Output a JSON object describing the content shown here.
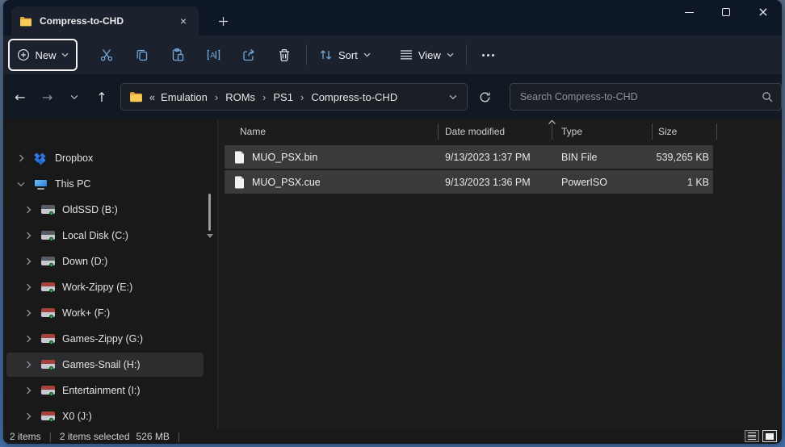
{
  "colors": {
    "accent_icon_blue": "#70a9dc",
    "folder_yellow": "#f8c955",
    "selection_gray": "#3a3a3c",
    "dropbox_blue": "#2f7cf0",
    "drive_led_green": "#2fae4e",
    "drive_stripe_red": "#a8423c",
    "titlebar_navy": "#0d1726"
  },
  "titlebar": {
    "tab_title": "Compress-to-CHD",
    "close_tab_glyph": "×",
    "close_window_glyph": "×"
  },
  "toolbar": {
    "new_label": "New",
    "sort_label": "Sort",
    "view_label": "View"
  },
  "addressbar": {
    "overflow_indicator": "«",
    "separator": "›",
    "crumbs": [
      "Emulation",
      "ROMs",
      "PS1",
      "Compress-to-CHD"
    ]
  },
  "search": {
    "placeholder": "Search Compress-to-CHD"
  },
  "sidebar": {
    "items": [
      {
        "label": "Dropbox",
        "icon": "dropbox-icon",
        "level": 0,
        "expanded": false,
        "highlighted": false
      },
      {
        "label": "This PC",
        "icon": "computer-icon",
        "level": 0,
        "expanded": true,
        "highlighted": false
      },
      {
        "label": "OldSSD (B:)",
        "icon": "drive-icon",
        "level": 1,
        "expanded": false,
        "highlighted": false
      },
      {
        "label": "Local Disk (C:)",
        "icon": "drive-icon",
        "level": 1,
        "expanded": false,
        "highlighted": false
      },
      {
        "label": "Down (D:)",
        "icon": "drive-icon",
        "level": 1,
        "expanded": false,
        "highlighted": false
      },
      {
        "label": "Work-Zippy (E:)",
        "icon": "drive-red-icon",
        "level": 1,
        "expanded": false,
        "highlighted": false
      },
      {
        "label": "Work+ (F:)",
        "icon": "drive-red-icon",
        "level": 1,
        "expanded": false,
        "highlighted": false
      },
      {
        "label": "Games-Zippy (G:)",
        "icon": "drive-red-icon",
        "level": 1,
        "expanded": false,
        "highlighted": false
      },
      {
        "label": "Games-Snail (H:)",
        "icon": "drive-red-icon",
        "level": 1,
        "expanded": false,
        "highlighted": true
      },
      {
        "label": "Entertainment (I:)",
        "icon": "drive-red-icon",
        "level": 1,
        "expanded": false,
        "highlighted": false
      },
      {
        "label": "X0 (J:)",
        "icon": "drive-red-icon",
        "level": 1,
        "expanded": false,
        "highlighted": false
      }
    ]
  },
  "files": {
    "columns": [
      "Name",
      "Date modified",
      "Type",
      "Size"
    ],
    "sort_column": "Name",
    "sort_direction": "ascending",
    "rows": [
      {
        "name": "MUO_PSX.bin",
        "date_modified": "9/13/2023 1:37 PM",
        "type": "BIN File",
        "size": "539,265 KB",
        "selected": true
      },
      {
        "name": "MUO_PSX.cue",
        "date_modified": "9/13/2023 1:36 PM",
        "type": "PowerISO",
        "size": "1 KB",
        "selected": true
      }
    ]
  },
  "statusbar": {
    "item_count": "2 items",
    "selected": "2 items selected",
    "selected_size": "526 MB",
    "separator": "|"
  }
}
